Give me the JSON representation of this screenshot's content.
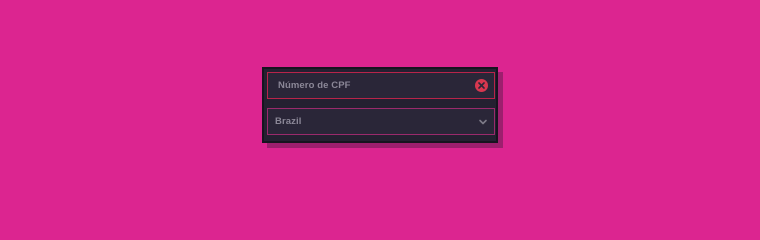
{
  "form": {
    "cpf_field": {
      "placeholder": "Número de CPF",
      "value": "",
      "state": "error",
      "clear_icon": "clear-circle-icon"
    },
    "country_select": {
      "selected": "Brazil",
      "icon": "chevron-down-icon"
    }
  },
  "colors": {
    "background": "#dc2590",
    "card": "#242031",
    "field": "#2a2638",
    "error_border": "#b8244a",
    "error_icon": "#d7374f",
    "text": "#8b8797"
  }
}
